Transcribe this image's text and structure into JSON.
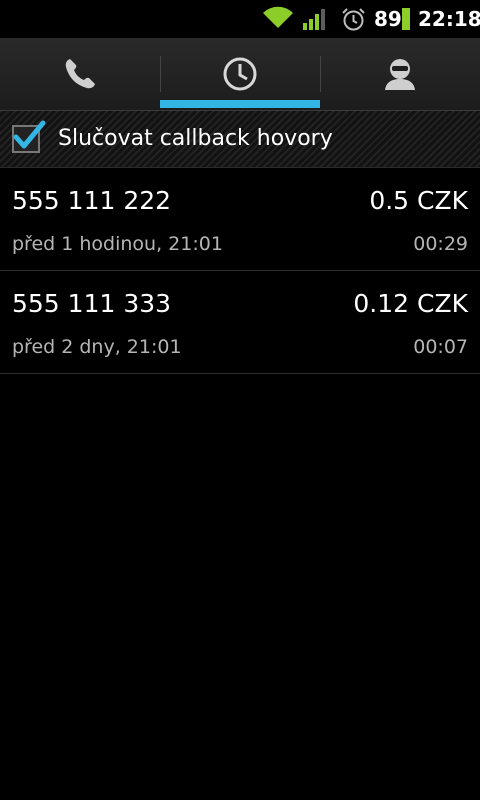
{
  "status_bar": {
    "battery_percent": "89",
    "time": "22:18",
    "icons": [
      "wifi-icon",
      "signal-icon",
      "alarm-icon",
      "battery-icon"
    ]
  },
  "tabs": [
    {
      "name": "phone-tab",
      "icon": "phone-icon",
      "selected": false
    },
    {
      "name": "recent-tab",
      "icon": "clock-icon",
      "selected": true
    },
    {
      "name": "contacts-tab",
      "icon": "contact-icon",
      "selected": false
    }
  ],
  "accent_color": "#33b5e5",
  "merge_option": {
    "label": "Slučovat callback hovory",
    "checked": true
  },
  "calls": [
    {
      "number": "555 111 222",
      "price": "0.5 CZK",
      "when": "před 1 hodinou, 21:01",
      "duration": "00:29"
    },
    {
      "number": "555 111 333",
      "price": "0.12 CZK",
      "when": "před 2 dny, 21:01",
      "duration": "00:07"
    }
  ]
}
